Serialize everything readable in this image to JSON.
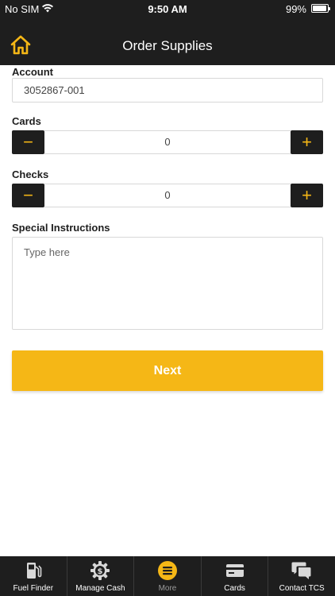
{
  "status_bar": {
    "carrier": "No SIM",
    "time": "9:50 AM",
    "battery": "99%"
  },
  "header": {
    "title": "Order Supplies",
    "home_icon": "home-icon"
  },
  "form": {
    "account_label": "Account",
    "account_value": "3052867-001",
    "cards_label": "Cards",
    "cards_value": "0",
    "checks_label": "Checks",
    "checks_value": "0",
    "minus_symbol": "−",
    "plus_symbol": "+",
    "special_label": "Special Instructions",
    "special_placeholder": "Type here",
    "next_label": "Next"
  },
  "tabs": [
    {
      "label": "Fuel Finder",
      "icon": "fuel-pump-icon"
    },
    {
      "label": "Manage Cash",
      "icon": "dollar-gear-icon"
    },
    {
      "label": "More",
      "icon": "menu-icon",
      "active": true
    },
    {
      "label": "Cards",
      "icon": "card-icon"
    },
    {
      "label": "Contact TCS",
      "icon": "chat-icon"
    }
  ],
  "colors": {
    "accent": "#f5b716",
    "dark": "#1e1e1e",
    "border": "#d8d8d8"
  }
}
